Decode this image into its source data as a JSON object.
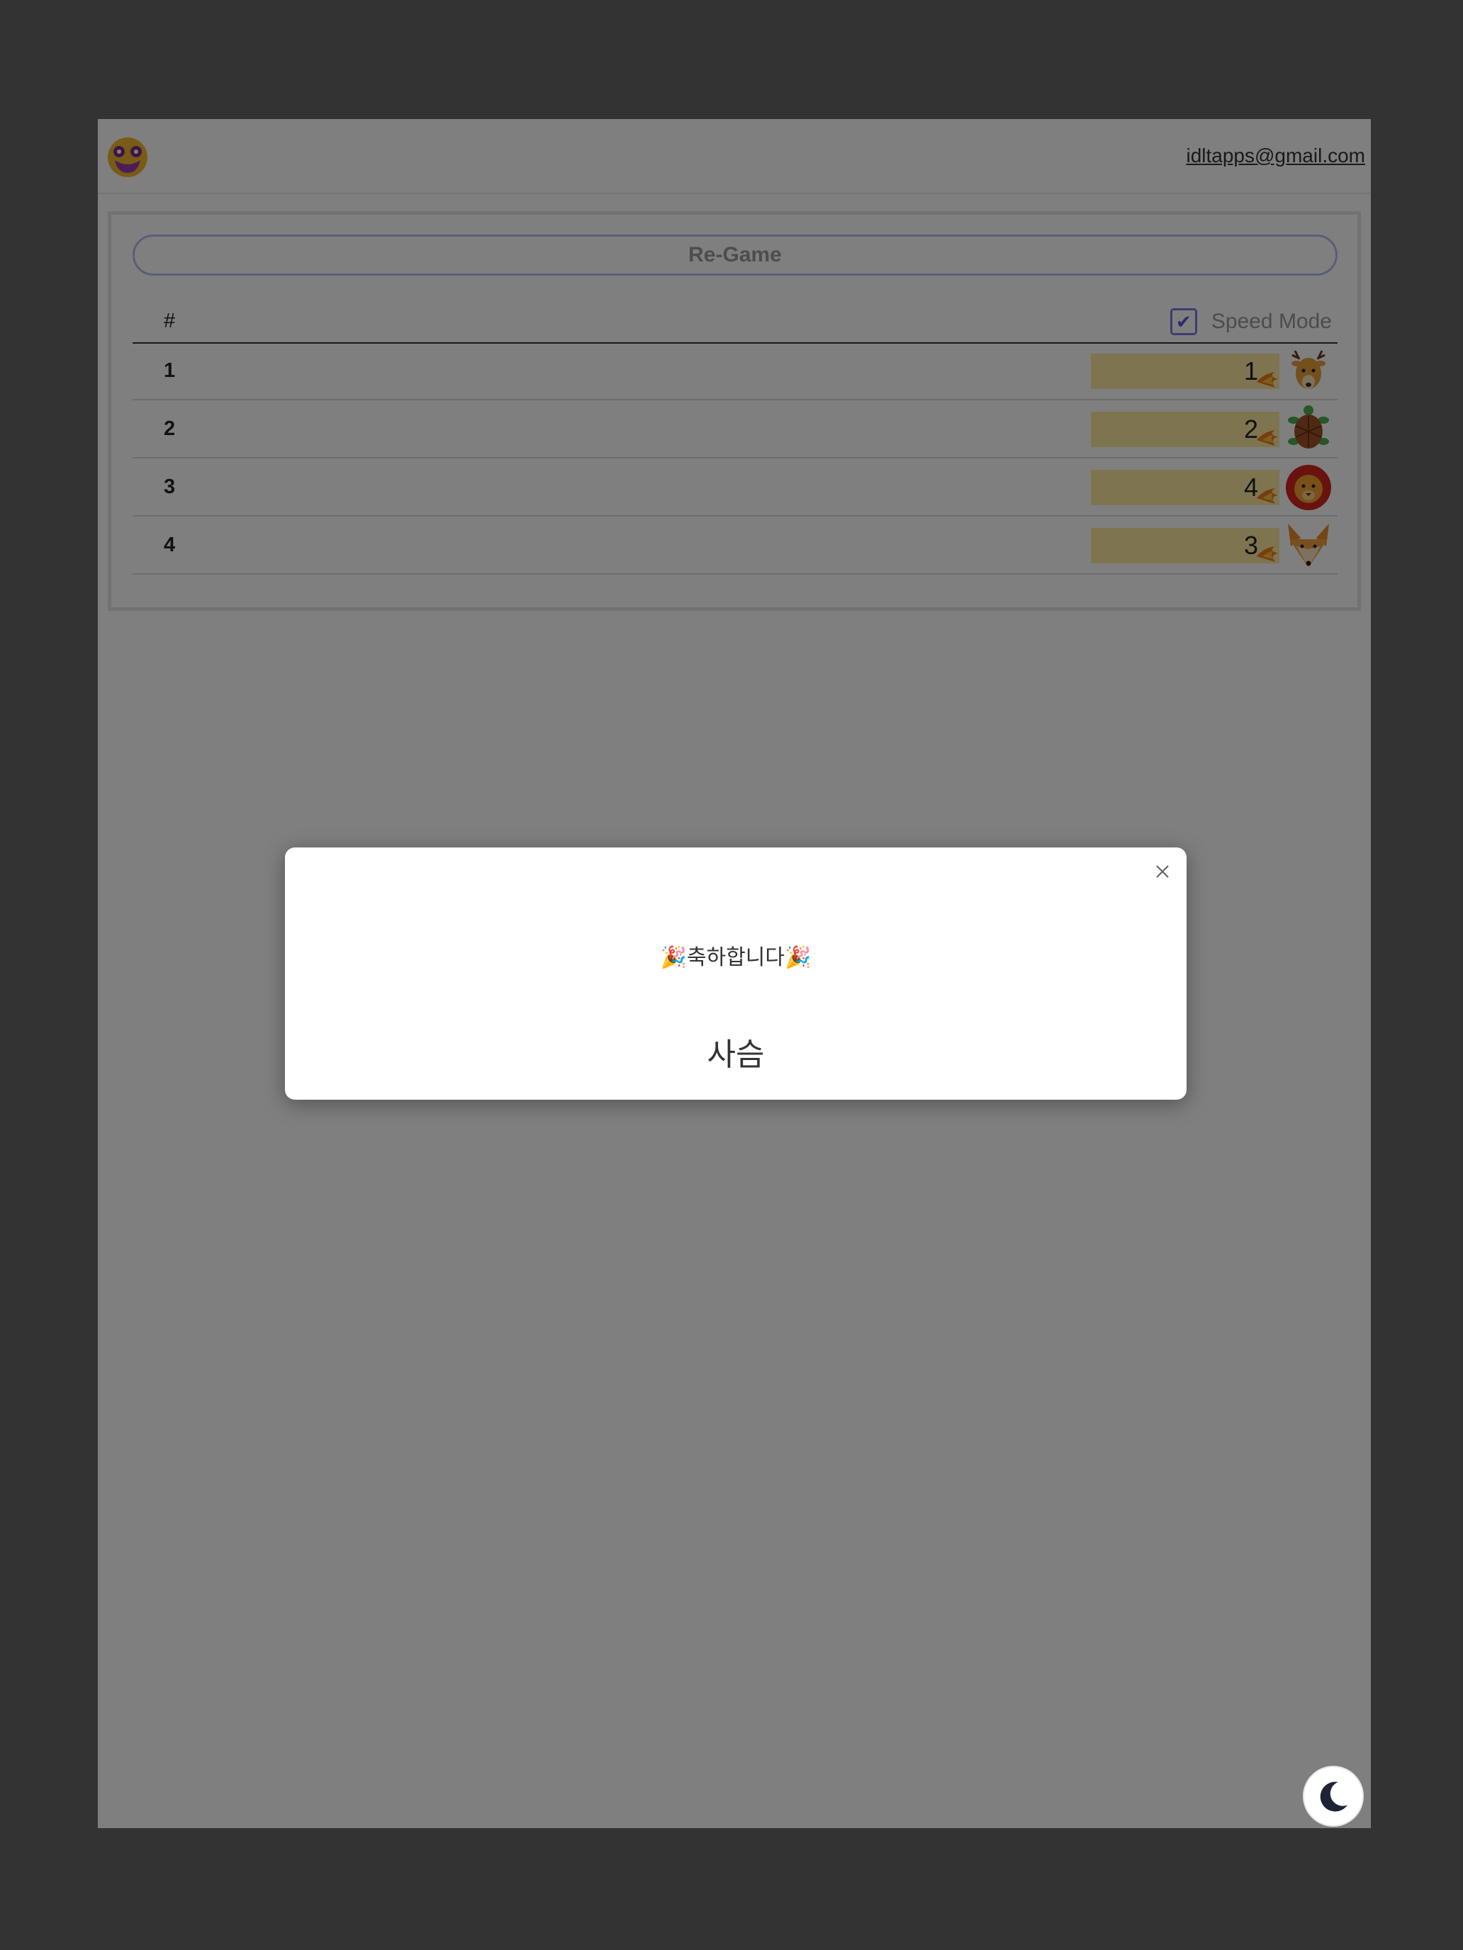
{
  "header": {
    "logo_icon": "monster-face-icon",
    "email": "idltapps@gmail.com"
  },
  "controls": {
    "regame_label": "Re-Game",
    "speed_mode_label": "Speed Mode",
    "speed_mode_checked": true
  },
  "table": {
    "hash_header": "#",
    "rows": [
      {
        "rank": "1",
        "value": "1",
        "animal": "deer-icon"
      },
      {
        "rank": "2",
        "value": "2",
        "animal": "turtle-icon"
      },
      {
        "rank": "3",
        "value": "4",
        "animal": "lion-icon"
      },
      {
        "rank": "4",
        "value": "3",
        "animal": "fox-icon"
      }
    ]
  },
  "modal": {
    "congrats": "🎉축하합니다🎉",
    "winner": "사슴"
  },
  "colors": {
    "accent": "#7b76e8",
    "bar": "#fde9a0",
    "page_bg": "#333333"
  }
}
